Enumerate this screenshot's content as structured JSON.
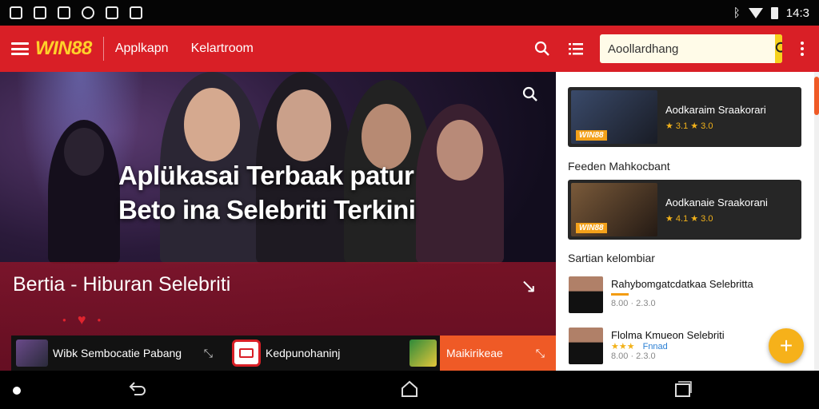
{
  "status_bar": {
    "time": "14:3",
    "left_icons": [
      "gallery-icon",
      "photo-icon",
      "image-icon",
      "clock-icon",
      "image-icon",
      "picture-icon"
    ],
    "right_icons": [
      "bluetooth-icon",
      "wifi-icon",
      "battery-icon"
    ]
  },
  "app_bar": {
    "logo": "WIN88",
    "nav": [
      "Applkapn",
      "Kelartroom"
    ],
    "search_placeholder": "Aoollardhang"
  },
  "hero": {
    "title_line1": "Aplükasai Terbaak patur",
    "title_line2": "Beto ina Selebriti Terkini",
    "band_title": "Bertia - Hiburan Selebriti",
    "band_arrow": "↘"
  },
  "tabs": [
    {
      "label": "Wibk Sembocatie Pabang",
      "close": "⤡"
    },
    {
      "label": "Kedpunohaninj",
      "close": "⤡"
    },
    {
      "label": "Maikirikeae",
      "close": "⤡"
    }
  ],
  "sidebar": {
    "features": [
      {
        "title": "Aodkaraim Sraakorari",
        "rating": "★ 3.1  ★ 3.0",
        "badge": "WIN88"
      },
      {
        "title": "Aodkanaie Sraakorani",
        "rating": "★ 4.1  ★ 3.0",
        "badge": "WIN88"
      }
    ],
    "section1": "Feeden Mahkocbant",
    "section2": "Sartian kelombiar",
    "list": [
      {
        "title": "Rahybomgatcdatkaa Selebritta",
        "meta": "8.00 · 2.3.0",
        "rating": "",
        "badge": ""
      },
      {
        "title": "Flolma Kmueon Selebriti",
        "meta": "8.00 · 2.3.0",
        "rating": "★★★",
        "badge": "Fnnad"
      }
    ]
  },
  "fab": {
    "label": "+"
  },
  "colors": {
    "brand": "#d91f26",
    "accent": "#f6d11d",
    "tab_active": "#ef5a26"
  }
}
